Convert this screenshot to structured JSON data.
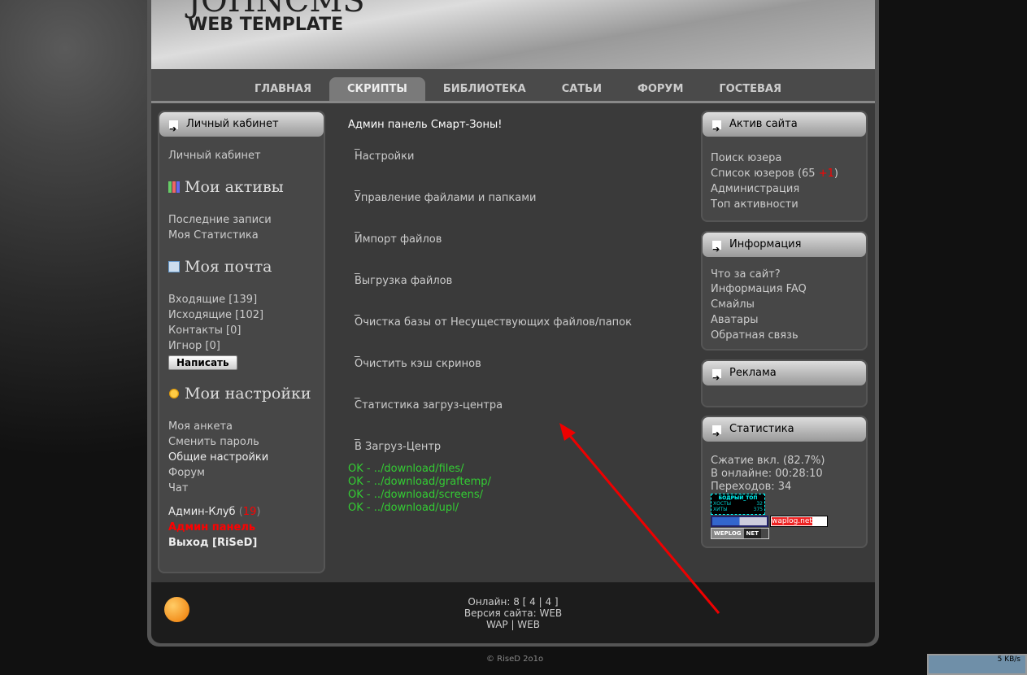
{
  "header": {
    "logo_top": "JOHNCMS",
    "logo_sub": "WEB TEMPLATE"
  },
  "nav": [
    {
      "label": "ГЛАВНАЯ"
    },
    {
      "label": "СКРИПТЫ",
      "active": true
    },
    {
      "label": "БИБЛИОТЕКА"
    },
    {
      "label": "САТЬИ"
    },
    {
      "label": "ФОРУМ"
    },
    {
      "label": "ГОСТЕВАЯ"
    }
  ],
  "left": {
    "box_title": "Личный кабинет",
    "cabinet_link": "Личный кабинет",
    "assets": {
      "title": "Мои активы",
      "items": [
        "Последние записи",
        "Моя Статистика"
      ]
    },
    "mail": {
      "title": "Моя почта",
      "items": [
        "Входящие [139]",
        "Исходящие [102]",
        "Контакты [0]",
        "Игнор [0]"
      ],
      "write_button": "Написать"
    },
    "settings": {
      "title": "Мои настройки",
      "items": [
        "Моя анкета",
        "Сменить пароль",
        "Общие настройки",
        "Форум",
        "Чат"
      ]
    },
    "admin_club": "Админ-Клуб",
    "admin_club_count": "19",
    "admin_panel": "Админ панель",
    "logout": "Выход [RiSeD]"
  },
  "main": {
    "title": "Админ панель Смарт-Зоны!",
    "dash": "_",
    "items": [
      "Настройки",
      "Управление файлами и папками",
      "Импорт файлов",
      "Выгрузка файлов",
      "Очистка базы от Несуществующих файлов/папок",
      "Очистить кэш скринов",
      "Статистика загруз-центра",
      "В Загруз-Центр"
    ],
    "ok_lines": [
      "OK - ../download/files/",
      "OK - ../download/graftemp/",
      "OK - ../download/screens/",
      "OK - ../download/upl/"
    ]
  },
  "right": {
    "active": {
      "title": "Актив сайта",
      "items": [
        "Поиск юзера",
        "Список юзеров (65 ",
        "Администрация",
        "Топ активности"
      ],
      "new_count": "+1",
      "close": ")"
    },
    "info": {
      "title": "Информация",
      "items": [
        "Что за сайт?",
        "Информация FAQ",
        "Смайлы",
        "Аватары",
        "Обратная связь"
      ]
    },
    "ads": {
      "title": "Реклама"
    },
    "stats": {
      "title": "Статистика",
      "lines": [
        "Сжатие вкл. (82.7%)",
        "В онлайне: 00:28:10",
        "Переходов: 34"
      ],
      "counter1": {
        "name": "БОДРЫЙ_ТОП",
        "hosts_label": "ХОСТЫ",
        "hosts": "32",
        "hits_label": "ХИТЫ",
        "hits": "375"
      },
      "counter2": "waplog.net",
      "counter3a": "WEPLOG",
      "counter3b": "NET"
    }
  },
  "footer": {
    "online": "Онлайн: 8 [ 4 | 4 ]",
    "version": "Версия сайта: WEB",
    "links": "WAP | WEB",
    "copyright": "© RiseD 2o1o"
  },
  "tray": {
    "speed": "5 KB/s"
  },
  "colors": {
    "accent_red": "#ff0000",
    "ok_green": "#33cc33"
  }
}
